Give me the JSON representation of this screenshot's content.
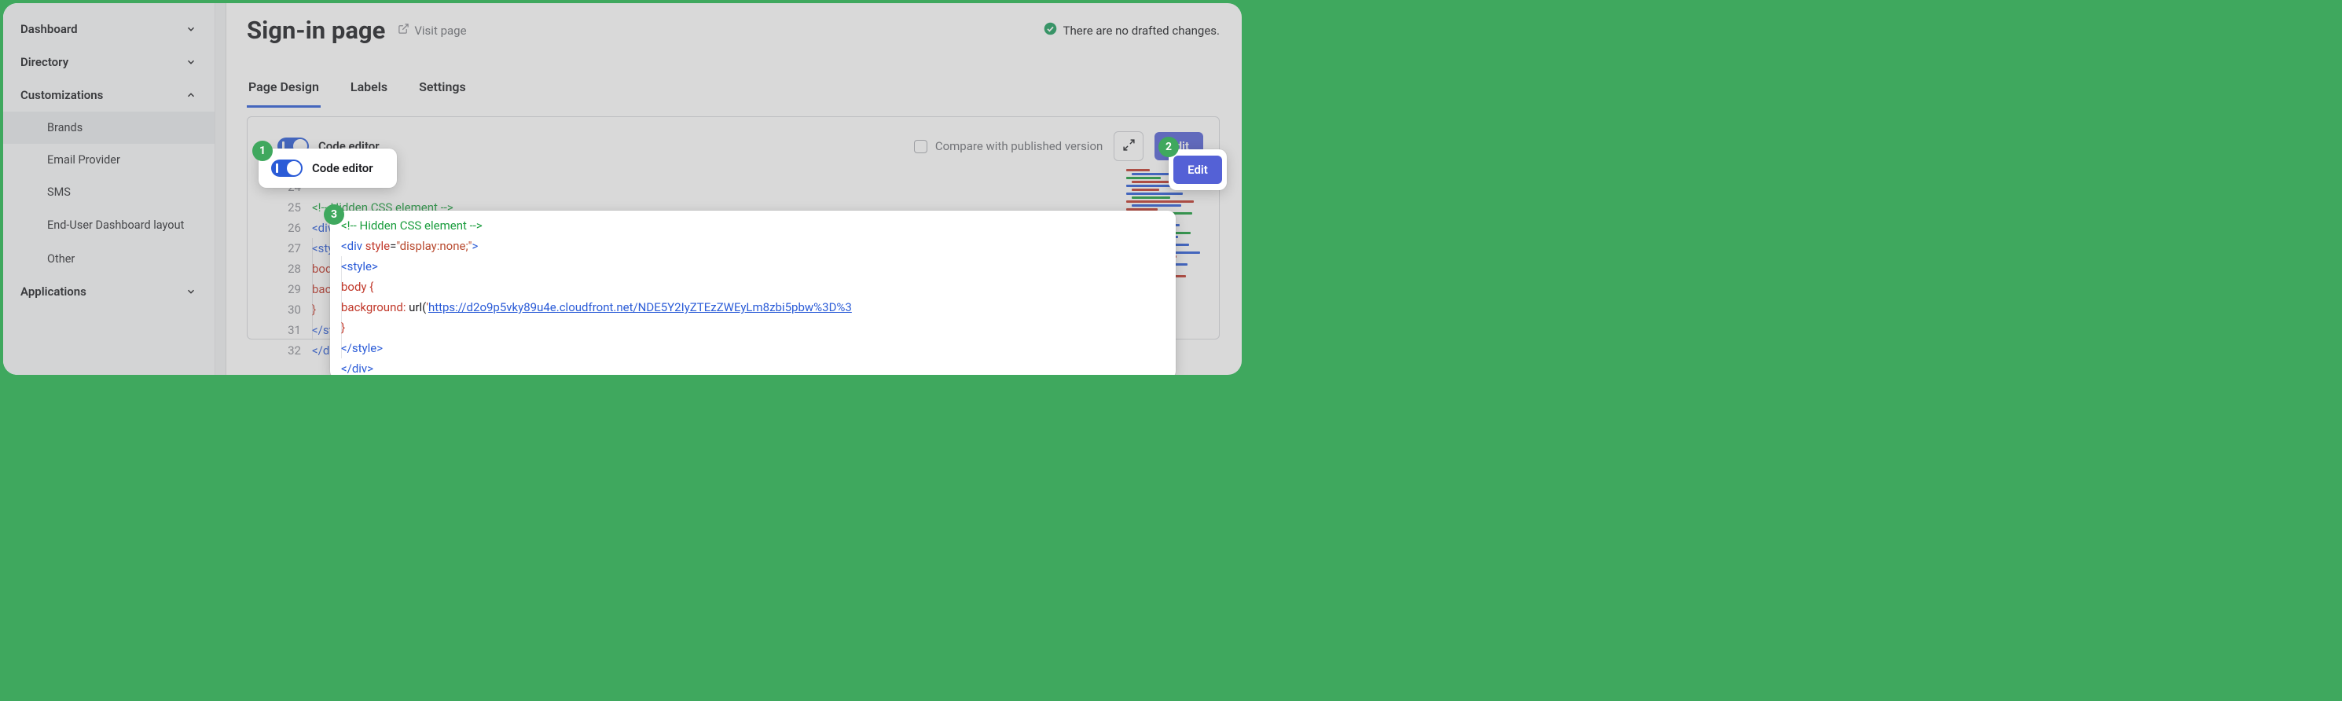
{
  "sidebar": {
    "items": [
      {
        "label": "Dashboard",
        "expanded": false
      },
      {
        "label": "Directory",
        "expanded": false
      },
      {
        "label": "Customizations",
        "expanded": true,
        "children": [
          {
            "label": "Brands",
            "active": true
          },
          {
            "label": "Email Provider"
          },
          {
            "label": "SMS"
          },
          {
            "label": "End-User Dashboard layout"
          },
          {
            "label": "Other"
          }
        ]
      },
      {
        "label": "Applications",
        "expanded": false
      }
    ]
  },
  "header": {
    "title": "Sign-in page",
    "visit_label": "Visit page",
    "status_text": "There are no drafted changes."
  },
  "tabs": [
    {
      "label": "Page Design",
      "active": true
    },
    {
      "label": "Labels"
    },
    {
      "label": "Settings"
    }
  ],
  "panel": {
    "toggle_label": "Code editor",
    "toggle_on": true,
    "compare_label": "Compare with published version",
    "edit_label": "Edit"
  },
  "editor": {
    "line_numbers": [
      24,
      25,
      26,
      27,
      28,
      29,
      30,
      31,
      32
    ],
    "lines": [
      {
        "n": 24,
        "segs": []
      },
      {
        "n": 25,
        "segs": [
          {
            "t": "<!-- Hidden CSS element -->",
            "c": "c-comment"
          }
        ]
      },
      {
        "n": 26,
        "segs": [
          {
            "t": "<",
            "c": "c-tag"
          },
          {
            "t": "div ",
            "c": "c-tag"
          },
          {
            "t": "style",
            "c": "c-attr"
          },
          {
            "t": "=",
            "c": "c-plain"
          },
          {
            "t": "\"display:none;\"",
            "c": "c-str"
          },
          {
            "t": ">",
            "c": "c-tag"
          }
        ]
      },
      {
        "n": 27,
        "indent": 1,
        "segs": [
          {
            "t": "<",
            "c": "c-tag"
          },
          {
            "t": "style",
            "c": "c-tag"
          },
          {
            "t": ">",
            "c": "c-tag"
          }
        ]
      },
      {
        "n": 28,
        "indent": 2,
        "segs": [
          {
            "t": "body {",
            "c": "c-attr"
          }
        ]
      },
      {
        "n": 29,
        "indent": 3,
        "segs": [
          {
            "t": "background:",
            "c": "c-attr"
          },
          {
            "t": " url(",
            "c": "c-plain"
          },
          {
            "t": "'",
            "c": "c-str"
          },
          {
            "t": "https://d2o9p5vky89u4e.cloudfront.net/NDE5Y2IyZTEzZWEyLm8zbi5pbw%3D%3",
            "c": "c-url"
          }
        ]
      },
      {
        "n": 30,
        "indent": 2,
        "segs": [
          {
            "t": "}",
            "c": "c-attr"
          }
        ]
      },
      {
        "n": 31,
        "indent": 1,
        "segs": [
          {
            "t": "</",
            "c": "c-tag"
          },
          {
            "t": "style",
            "c": "c-tag"
          },
          {
            "t": ">",
            "c": "c-tag"
          }
        ]
      },
      {
        "n": 32,
        "segs": [
          {
            "t": "</",
            "c": "c-tag"
          },
          {
            "t": "div",
            "c": "c-tag"
          },
          {
            "t": ">",
            "c": "c-tag"
          }
        ]
      }
    ]
  },
  "badges": {
    "b1": "1",
    "b2": "2",
    "b3": "3"
  }
}
